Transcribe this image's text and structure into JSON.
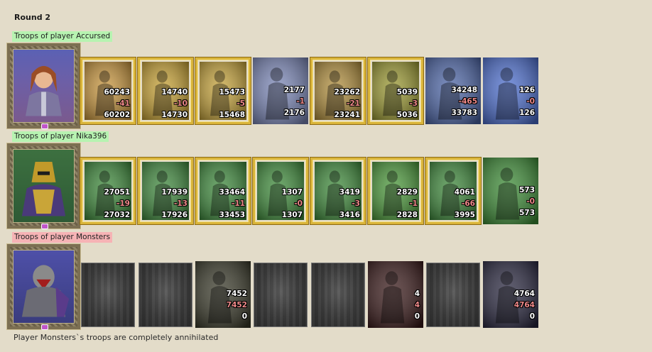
{
  "round_title": "Round 2",
  "colors": {
    "background": "#e3dcc9",
    "label_green": "#b7f3b1",
    "label_red": "#f6b3b5",
    "frame_gold": "#d9b43a"
  },
  "players": [
    {
      "label": "Troops of player Accursed",
      "hero_icon": "hero-portrait-accursed",
      "units": [
        {
          "icon": "unit-unicorn-guardian",
          "count": "60243",
          "loss": "-41",
          "remaining": "60202",
          "frame": "gold",
          "tint": "#c9963c"
        },
        {
          "icon": "unit-golden-knight",
          "count": "14740",
          "loss": "-10",
          "remaining": "14730",
          "frame": "gold",
          "tint": "#c8a233"
        },
        {
          "icon": "unit-royal-cavalier",
          "count": "15473",
          "loss": "-5",
          "remaining": "15468",
          "frame": "gold",
          "tint": "#c7a43a"
        },
        {
          "icon": "unit-griffin",
          "count": "2177",
          "loss": "-1",
          "remaining": "2176",
          "frame": "plain",
          "tint": "#7b87b8"
        },
        {
          "icon": "unit-archer",
          "count": "23262",
          "loss": "-21",
          "remaining": "23241",
          "frame": "gold",
          "tint": "#b28f3c"
        },
        {
          "icon": "unit-cleric",
          "count": "5039",
          "loss": "-3",
          "remaining": "5036",
          "frame": "gold",
          "tint": "#9c9a32"
        },
        {
          "icon": "unit-dwarf-warrior",
          "count": "34248",
          "loss": "-465",
          "remaining": "33783",
          "frame": "plain",
          "tint": "#4d66a8"
        },
        {
          "icon": "unit-mage",
          "count": "126",
          "loss": "-0",
          "remaining": "126",
          "frame": "plain",
          "tint": "#4d6fd0"
        }
      ]
    },
    {
      "label": "Troops of player Nika396",
      "hero_icon": "hero-portrait-nika396",
      "units": [
        {
          "icon": "unit-elf-gunner",
          "count": "27051",
          "loss": "-19",
          "remaining": "27032",
          "frame": "gold",
          "tint": "#3d8a3a"
        },
        {
          "icon": "unit-elf-warrior",
          "count": "17939",
          "loss": "-13",
          "remaining": "17926",
          "frame": "gold",
          "tint": "#3f8a3d"
        },
        {
          "icon": "unit-elf-spearman",
          "count": "33464",
          "loss": "-11",
          "remaining": "33453",
          "frame": "gold",
          "tint": "#3e8b3c"
        },
        {
          "icon": "unit-green-griffin",
          "count": "1307",
          "loss": "-0",
          "remaining": "1307",
          "frame": "gold",
          "tint": "#3f8d3b"
        },
        {
          "icon": "unit-elf-archer",
          "count": "3419",
          "loss": "-3",
          "remaining": "3416",
          "frame": "gold",
          "tint": "#3f8c3b"
        },
        {
          "icon": "unit-dryad",
          "count": "2829",
          "loss": "-1",
          "remaining": "2828",
          "frame": "gold",
          "tint": "#4b9a3a"
        },
        {
          "icon": "unit-druid",
          "count": "4061",
          "loss": "-66",
          "remaining": "3995",
          "frame": "gold",
          "tint": "#3e8a3b"
        },
        {
          "icon": "unit-green-sage",
          "count": "573",
          "loss": "-0",
          "remaining": "573",
          "frame": "plain",
          "tint": "#3d8d36"
        }
      ]
    },
    {
      "label": "Troops of player Monsters",
      "hero_icon": "hero-portrait-monsters",
      "units": [
        {
          "icon": "empty-slot",
          "empty": true
        },
        {
          "icon": "empty-slot",
          "empty": true
        },
        {
          "icon": "unit-orc-warlord",
          "count": "7452",
          "loss": "7452",
          "remaining": "0",
          "frame": "plain",
          "tint": "#3a3a2a"
        },
        {
          "icon": "empty-slot",
          "empty": true
        },
        {
          "icon": "empty-slot",
          "empty": true
        },
        {
          "icon": "unit-red-demon",
          "count": "4",
          "loss": "4",
          "remaining": "0",
          "frame": "plain",
          "tint": "#3a1a1a"
        },
        {
          "icon": "empty-slot",
          "empty": true
        },
        {
          "icon": "unit-dark-dragon",
          "count": "4764",
          "loss": "4764",
          "remaining": "0",
          "frame": "plain",
          "tint": "#2a2840"
        }
      ]
    }
  ],
  "footer_text": "Player Monsters`s troops are completely annihilated"
}
